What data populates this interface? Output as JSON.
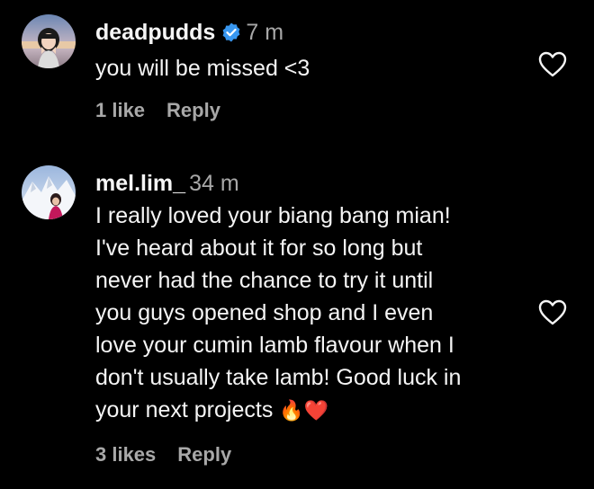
{
  "comments": [
    {
      "username": "deadpudds",
      "verified": true,
      "time": "7 m",
      "text": "you will be missed <3",
      "likes": "1 like",
      "reply": "Reply"
    },
    {
      "username": "mel.lim_",
      "verified": false,
      "time": "34 m",
      "text_lines": [
        "I really loved your biang bang mian!",
        "I've heard about it for so long but",
        "never had the chance to try it until",
        "you guys opened shop and I even",
        "love your cumin lamb flavour when I",
        "don't usually take lamb! Good luck in",
        "your next projects"
      ],
      "emojis": "🔥❤️",
      "likes": "3 likes",
      "reply": "Reply"
    }
  ],
  "icons": {
    "verified": "verified-badge-icon",
    "like": "heart-outline-icon"
  },
  "colors": {
    "background": "#000000",
    "primary_text": "#f5f5f5",
    "secondary_text": "#a8a8a8",
    "verified_blue": "#3897f0"
  }
}
